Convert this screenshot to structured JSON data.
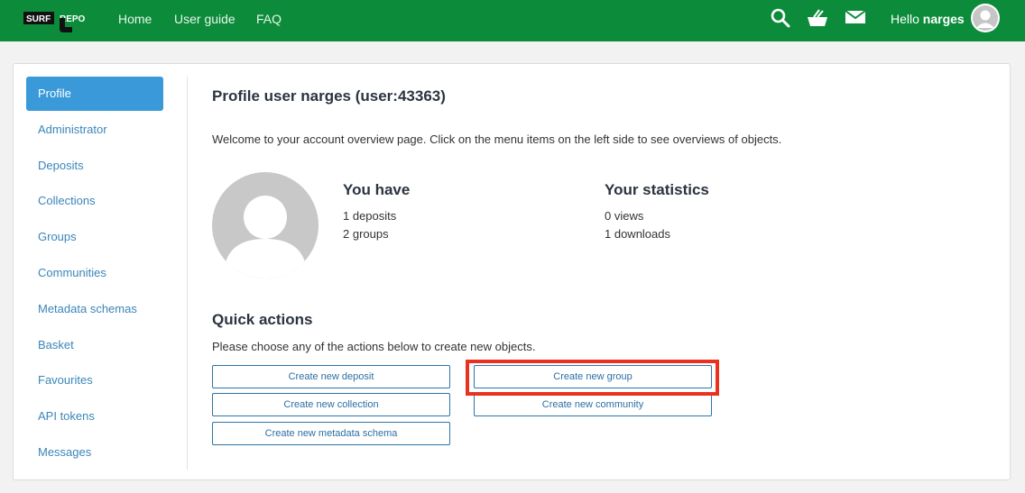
{
  "navbar": {
    "logo_text_left": "SURF",
    "logo_text_right": "REPO",
    "links": [
      "Home",
      "User guide",
      "FAQ"
    ],
    "hello_prefix": "Hello ",
    "username": "narges",
    "icons": [
      "search-icon",
      "basket-icon",
      "mail-icon"
    ],
    "color": "#0c8c3b"
  },
  "sidebar": {
    "items": [
      {
        "label": "Profile",
        "active": true
      },
      {
        "label": "Administrator"
      },
      {
        "label": "Deposits"
      },
      {
        "label": "Collections"
      },
      {
        "label": "Groups"
      },
      {
        "label": "Communities"
      },
      {
        "label": "Metadata schemas"
      },
      {
        "label": "Basket"
      },
      {
        "label": "Favourites"
      },
      {
        "label": "API tokens"
      },
      {
        "label": "Messages"
      }
    ]
  },
  "main": {
    "title": "Profile user narges (user:43363)",
    "welcome": "Welcome to your account overview page. Click on the menu items on the left side to see overviews of objects.",
    "you_have": {
      "heading": "You have",
      "lines": [
        "1 deposits",
        "2 groups"
      ]
    },
    "statistics": {
      "heading": "Your statistics",
      "lines": [
        "0 views",
        "1 downloads"
      ]
    },
    "quick_actions": {
      "heading": "Quick actions",
      "description": "Please choose any of the actions below to create new objects.",
      "buttons": [
        "Create new deposit",
        "Create new collection",
        "Create new metadata schema",
        "Create new group",
        "Create new community"
      ]
    }
  },
  "colors": {
    "accent": "#3a9ad9",
    "link": "#3a86b8",
    "highlight": "#e8321f"
  }
}
